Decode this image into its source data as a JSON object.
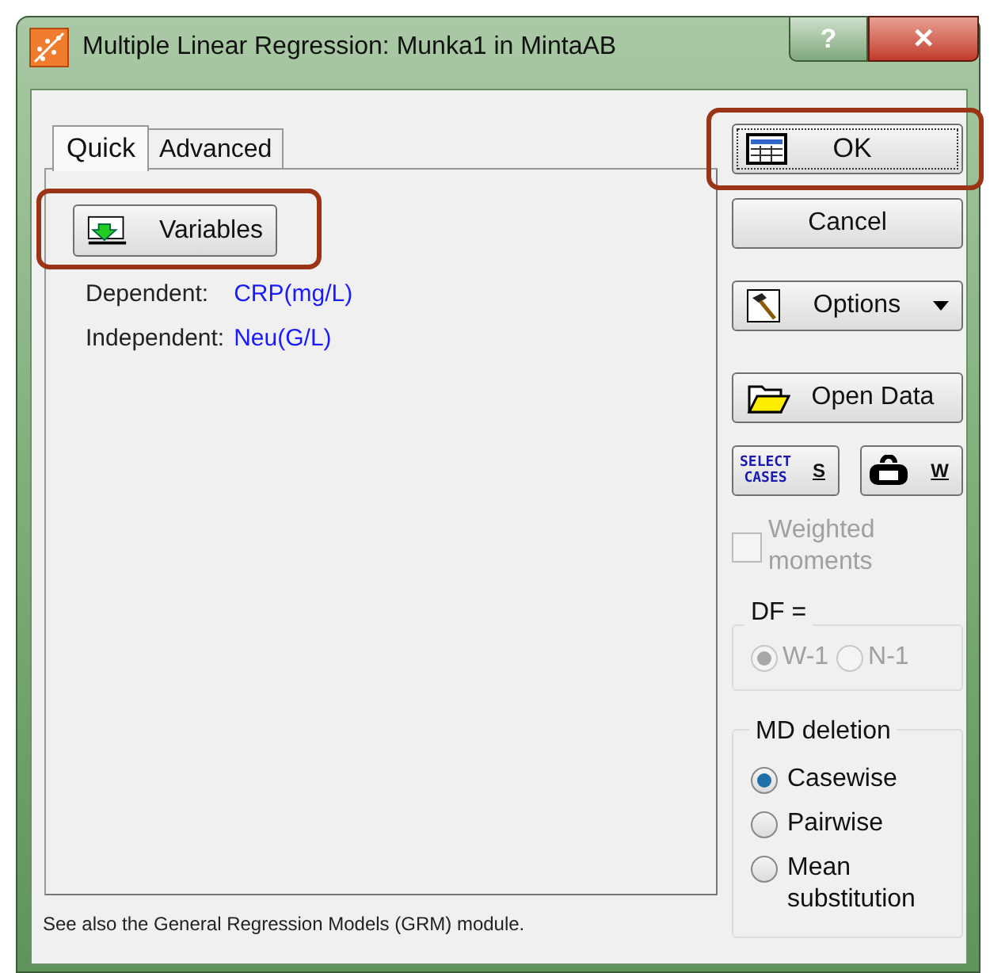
{
  "window": {
    "title": "Multiple Linear Regression: Munka1 in MintaAB",
    "help": "?",
    "close": "✕"
  },
  "tabs": [
    {
      "label": "Quick",
      "selected": true
    },
    {
      "label": "Advanced",
      "selected": false
    }
  ],
  "variables_button": {
    "label": "Variables",
    "highlighted": true
  },
  "variables": [
    {
      "label": "Dependent:",
      "value": "CRP(mg/L)"
    },
    {
      "label": "Independent:",
      "value": "Neu(G/L)"
    }
  ],
  "buttons": [
    {
      "kind": "ok",
      "label": "OK",
      "highlighted": true
    },
    {
      "kind": "plain",
      "label": "Cancel",
      "highlighted": false
    },
    {
      "kind": "menu",
      "label": "Options",
      "highlighted": false
    },
    {
      "kind": "open",
      "label": "Open Data",
      "highlighted": false
    }
  ],
  "small_buttons": [
    {
      "kind": "select",
      "icon_text": [
        "SELECT",
        "CASES"
      ],
      "label": "S"
    },
    {
      "kind": "weight",
      "label": "W"
    }
  ],
  "weighted_moments": {
    "label": "Weighted moments",
    "checked": false,
    "disabled": true
  },
  "df_group": {
    "title": "DF =",
    "disabled": true,
    "options": [
      {
        "label": "W-1",
        "selected": true
      },
      {
        "label": "N-1",
        "selected": false
      }
    ]
  },
  "md_group": {
    "title": "MD deletion",
    "options": [
      {
        "label": "Casewise",
        "selected": true
      },
      {
        "label": "Pairwise",
        "selected": false
      },
      {
        "label": "Mean substitution",
        "selected": false
      }
    ]
  },
  "footer": "See also the General Regression Models (GRM) module."
}
